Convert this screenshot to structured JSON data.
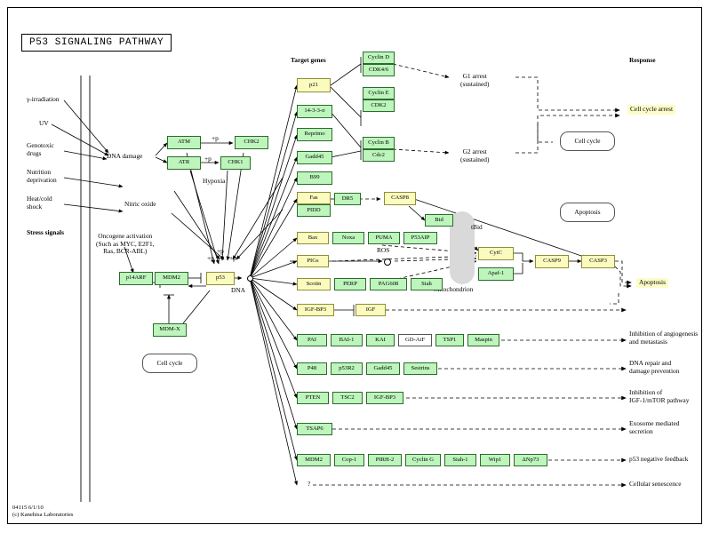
{
  "title": "P53 SIGNALING PATHWAY",
  "footer": {
    "line1": "04115 6/1/10",
    "line2": "(c) Kanehisa Laboratories"
  },
  "colors": {
    "gene_fill": "#bdf5bd",
    "gene_border": "#2d6b2d",
    "highlight_fill": "#fbfbc0",
    "membrane": "#8d8d8d",
    "mitochondrion": "#d9d9d9"
  },
  "headers": {
    "target_genes": "Target genes",
    "response": "Response",
    "stress_signals": "Stress signals"
  },
  "stress": {
    "gamma": "γ-irradiation",
    "uv": "UV",
    "genotoxic": "Genotoxic\ndrugs",
    "nutrition": "Nutrition\ndeprivation",
    "heatcold": "Heat/cold\nshock",
    "dna_damage": "DNA damage",
    "hypoxia": "Hypoxia",
    "nitric_oxide": "Nitric oxide",
    "oncogene": "Oncogene activation\n(Such as MYC, E2F1,\nRas, BCR-ABL)"
  },
  "phospho": {
    "p1": "+p",
    "p2": "+p",
    "p3": "+p",
    "p4": "+p",
    "p5": "+p",
    "p6": "+p"
  },
  "labels": {
    "dna": "DNA",
    "ros": "ROS",
    "tbid": "tBid",
    "mitochondrion": "Mitochondrion",
    "g1_arrest": "G1 arrest\n(sustained)",
    "g2_arrest": "G2 arrest\n(sustained)",
    "question": "?"
  },
  "maplinks": {
    "cell_cycle_left": "Cell cycle",
    "cell_cycle_right": "Cell cycle",
    "apoptosis": "Apoptosis"
  },
  "sensors": [
    {
      "name": "ATM",
      "label": "ATM"
    },
    {
      "name": "ATR",
      "label": "ATR"
    },
    {
      "name": "CHK2",
      "label": "CHK2"
    },
    {
      "name": "CHK1",
      "label": "CHK1"
    }
  ],
  "core": [
    {
      "name": "p14ARF",
      "label": "p14ARF",
      "highlight": false
    },
    {
      "name": "MDM2",
      "label": "MDM2",
      "highlight": false
    },
    {
      "name": "p53",
      "label": "p53",
      "highlight": true
    },
    {
      "name": "MDM-X",
      "label": "MDM-X",
      "highlight": false
    }
  ],
  "target_genes": {
    "row_cellcycle": [
      {
        "label": "p21",
        "highlight": true
      },
      {
        "label": "14-3-3-σ",
        "highlight": false
      },
      {
        "label": "Reprimo",
        "highlight": false
      },
      {
        "label": "Gadd45",
        "highlight": false
      },
      {
        "label": "B99",
        "highlight": false
      }
    ],
    "cyclins": [
      {
        "label": "Cyclin D"
      },
      {
        "label": "CDK4/6"
      },
      {
        "label": "Cyclin E"
      },
      {
        "label": "CDK2"
      },
      {
        "label": "Cyclin B"
      },
      {
        "label": "Cdc2"
      }
    ],
    "apoptosis_rows": [
      {
        "label": "Fas",
        "highlight": true
      },
      {
        "label": "PIDD",
        "highlight": false
      },
      {
        "label": "DR5",
        "highlight": false
      },
      {
        "label": "CASP8",
        "highlight": true
      },
      {
        "label": "Bid",
        "highlight": false
      },
      {
        "label": "Bax",
        "highlight": true
      },
      {
        "label": "Noxa",
        "highlight": false
      },
      {
        "label": "PUMA",
        "highlight": false
      },
      {
        "label": "P53AIP",
        "highlight": false
      },
      {
        "label": "PIGs",
        "highlight": true
      },
      {
        "label": "Scotin",
        "highlight": true
      },
      {
        "label": "PERP",
        "highlight": false
      },
      {
        "label": "PAG608",
        "highlight": false
      },
      {
        "label": "Siah",
        "highlight": false
      }
    ],
    "mito_path": [
      {
        "label": "CytC",
        "highlight": true
      },
      {
        "label": "Apaf-1",
        "highlight": false
      },
      {
        "label": "CASP9",
        "highlight": true
      },
      {
        "label": "CASP3",
        "highlight": true
      }
    ],
    "igf_row": [
      {
        "label": "IGF-BP3",
        "highlight": true
      },
      {
        "label": "IGF",
        "highlight": true
      }
    ],
    "angiogenesis_row": [
      {
        "label": "PAI",
        "highlight": false
      },
      {
        "label": "BAI-1",
        "highlight": false
      },
      {
        "label": "KAI",
        "highlight": false
      },
      {
        "label": "GD-AiF",
        "highlight": false,
        "white": true
      },
      {
        "label": "TSP1",
        "highlight": false
      },
      {
        "label": "Maspin",
        "highlight": false
      }
    ],
    "dna_repair_row": [
      {
        "label": "P48",
        "highlight": false
      },
      {
        "label": "p53R2",
        "highlight": false
      },
      {
        "label": "Gadd45",
        "highlight": false
      },
      {
        "label": "Sestrins",
        "highlight": false
      }
    ],
    "igf_mtor_row": [
      {
        "label": "PTEN",
        "highlight": false
      },
      {
        "label": "TSC2",
        "highlight": false
      },
      {
        "label": "IGF-BP3",
        "highlight": false
      }
    ],
    "exosome_row": [
      {
        "label": "TSAP6",
        "highlight": false
      }
    ],
    "feedback_row": [
      {
        "label": "MDM2",
        "highlight": false
      },
      {
        "label": "Cop-1",
        "highlight": false
      },
      {
        "label": "PIRH-2",
        "highlight": false
      },
      {
        "label": "Cyclin G",
        "highlight": false
      },
      {
        "label": "Siah-1",
        "highlight": false
      },
      {
        "label": "Wip1",
        "highlight": false
      },
      {
        "label": "ΔNp73",
        "highlight": false
      }
    ]
  },
  "responses": [
    {
      "name": "cell-cycle-arrest",
      "label": "Cell cycle arrest",
      "highlight": true
    },
    {
      "name": "apoptosis",
      "label": "Apoptosis",
      "highlight": true
    },
    {
      "name": "inhibition-angiogenesis",
      "label": "Inhibition of angiogenesis\nand metastasis",
      "highlight": false
    },
    {
      "name": "dna-repair",
      "label": "DNA repair and\ndamage prevention",
      "highlight": false
    },
    {
      "name": "inhibition-igf-mtor",
      "label": "Inhibition of\nIGF-1/mTOR pathway",
      "highlight": false
    },
    {
      "name": "exosome-secretion",
      "label": "Exosome mediated\nsecretion",
      "highlight": false
    },
    {
      "name": "p53-negative-feedback",
      "label": "p53 negative feedback",
      "highlight": false
    },
    {
      "name": "cellular-senescence",
      "label": "Cellular senescence",
      "highlight": false
    }
  ]
}
